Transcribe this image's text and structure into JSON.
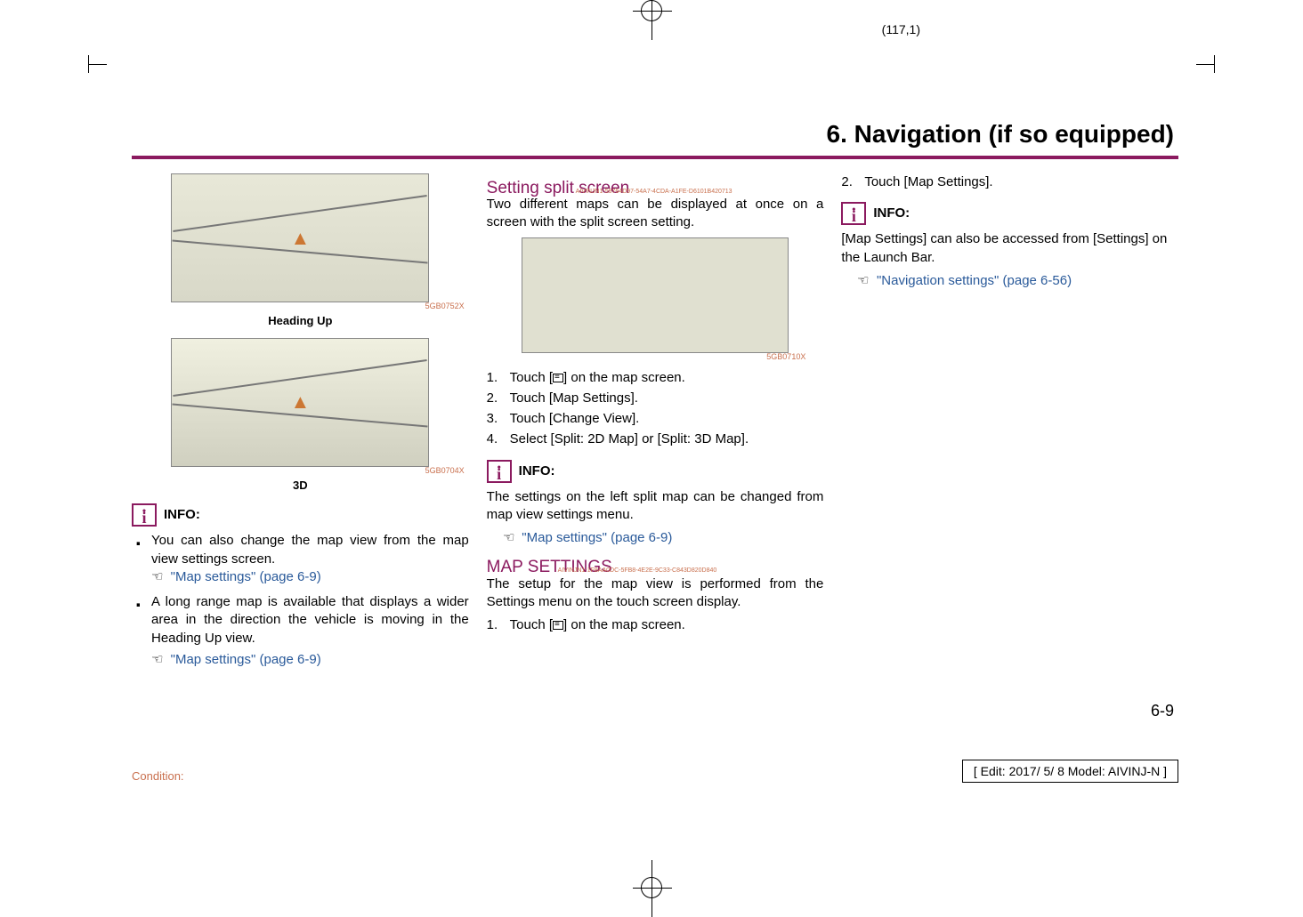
{
  "page_coord": "(117,1)",
  "chapter_title": "6. Navigation (if so equipped)",
  "col1": {
    "img1_id": "5GB0752X",
    "img1_caption": "Heading Up",
    "img2_id": "5GB0704X",
    "img2_caption": "3D",
    "info_label": "INFO:",
    "bullet1": "You can also change the map view from the map view settings screen.",
    "link1": "\"Map settings\" (page 6-9)",
    "bullet2": "A long range map is available that displays a wider area in the direction the vehicle is moving in the Heading Up view.",
    "link2": "\"Map settings\" (page 6-9)"
  },
  "col2": {
    "heading1": "Setting split screen",
    "guid1": "AIVINJN1-59764D97-54A7-4CDA-A1FE-D6101B420713",
    "para1": "Two different maps can be displayed at once on a screen with the split screen setting.",
    "img_id": "5GB0710X",
    "step1a": "Touch [",
    "step1b": "] on the map screen.",
    "step2": "Touch [Map Settings].",
    "step3": "Touch [Change View].",
    "step4": "Select [Split: 2D Map] or [Split: 3D Map].",
    "info_label": "INFO:",
    "info_text": "The settings on the left split map can be changed from map view settings menu.",
    "link1": "\"Map settings\" (page 6-9)",
    "heading2": "MAP SETTINGS",
    "guid2": "AIVINJN1-1F8AA0DC-5FB8-4E2E-9C33-C843D820D840",
    "para2": "The setup for the map view is performed from the Settings menu on the touch screen display.",
    "step_b1a": "Touch [",
    "step_b1b": "] on the map screen."
  },
  "col3": {
    "step2": "Touch [Map Settings].",
    "info_label": "INFO:",
    "info_text": "[Map Settings] can also be accessed from [Settings] on the Launch Bar.",
    "link1": "\"Navigation settings\" (page 6-56)"
  },
  "page_num": "6-9",
  "condition": "Condition:",
  "edit_info": "[ Edit: 2017/ 5/ 8    Model: AIVINJ-N ]"
}
